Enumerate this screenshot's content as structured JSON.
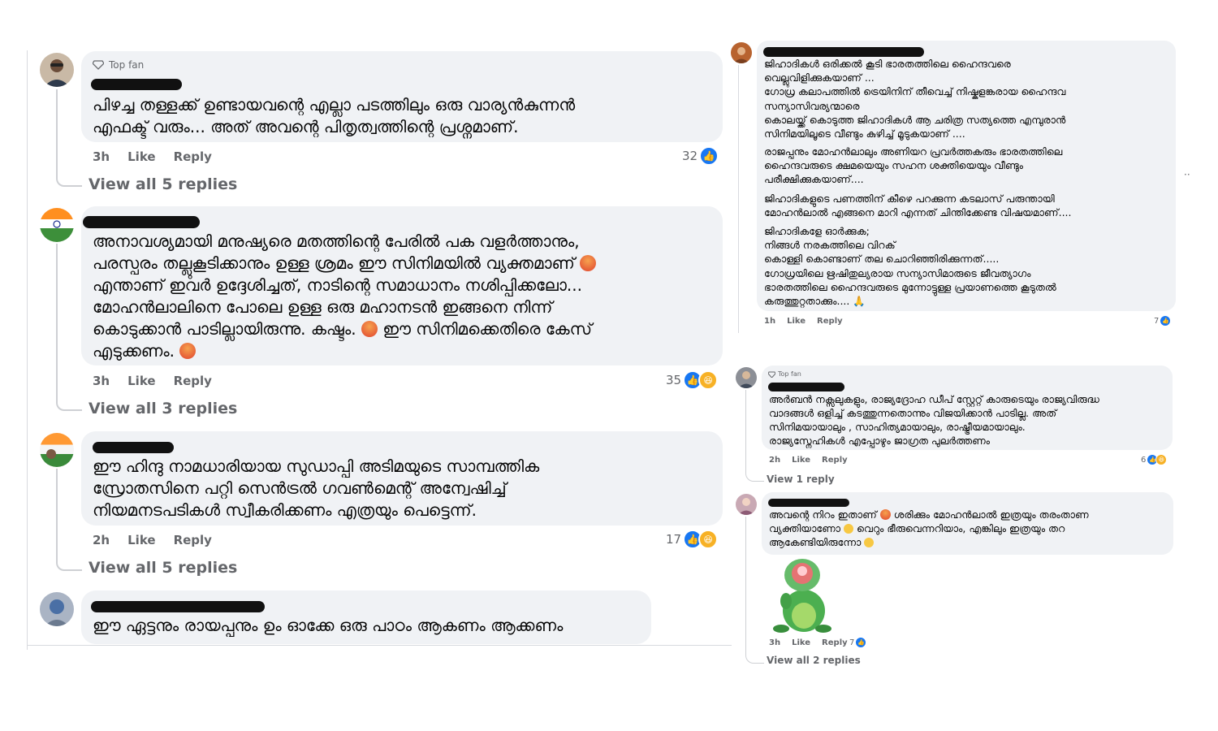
{
  "left": {
    "comments": [
      {
        "badge": "Top fan",
        "text": "പിഴച്ച തള്ളക്ക് ഉണ്ടായവന്റെ എല്ലാ പടത്തിലും ഒരു വാര്യൻകുന്നൻ\nഎഫക്ട് വരും... അത് അവന്റെ പിതൃത്വത്തിന്റെ പ്രശ്നമാണ്.",
        "time": "3h",
        "like": "Like",
        "reply": "Reply",
        "count": "32",
        "view_replies": "View all 5 replies"
      },
      {
        "text_lines": [
          "അനാവശ്യമായി മനുഷ്യരെ മതത്തിന്റെ പേരിൽ പക വളർത്താനും,",
          "പരസ്പരം തല്ലുകൂടിക്കാനും ഉള്ള ശ്രമം ഈ സിനിമയിൽ വ്യക്തമാണ്",
          "എന്താണ് ഇവർ ഉദ്ദേശിച്ചത്, നാടിന്റെ സമാധാനം നശിപ്പിക്കലോ...",
          "മോഹൻലാലിനെ പോലെ ഉള്ള ഒരു മഹാനടൻ ഇങ്ങനെ നിന്ന്",
          "കൊടുക്കാൻ പാടില്ലായിരുന്നു. കഷ്ടം.",
          " ഈ സിനിമക്കെതിരെ കേസ്",
          "എടുക്കണം."
        ],
        "time": "3h",
        "like": "Like",
        "reply": "Reply",
        "count": "35",
        "view_replies": "View all 3 replies"
      },
      {
        "text": "ഈ ഹിന്ദു നാമധാരിയായ സുഡാപ്പി അടിമയുടെ സാമ്പത്തിക\nസ്രോതസിനെ പറ്റി സെൻട്രൽ ഗവൺമെന്റ് അന്വേഷിച്ച്\nനിയമനടപടികൾ സ്വീകരിക്കണം എത്രയും പെട്ടെന്ന്.",
        "time": "2h",
        "like": "Like",
        "reply": "Reply",
        "count": "17",
        "view_replies": "View all 5 replies"
      },
      {
        "text": "ഈ ഏട്ടനും രായപ്പനും ഉം ഓക്കേ ഒരു പാഠം ആകണം ആക്കണം"
      }
    ]
  },
  "right": {
    "comments": [
      {
        "paragraphs": [
          "ജിഹാദികൾ ഒരിക്കൽ കൂടി ഭാരതത്തിലെ ഹൈന്ദവരെ\nവെല്ലുവിളിക്കുകയാണ് ...\nഗോധ്ര കലാപത്തിൽ ട്രെയിനിന് തീവെച്ച് നിഷ്കളങ്കരായ ഹൈന്ദവ\nസന്യാസിവര്യന്മാരെ\nകൊലയ്ക്ക് കൊടുത്ത ജിഹാദികൾ ആ ചരിത്ര സത്യത്തെ എമ്പുരാൻ\nസിനിമയിലൂടെ വീണ്ടും കുഴിച്ച് മൂടുകയാണ് ....",
          "രാജപ്പനും മോഹൻലാലും അണിയറ പ്രവർത്തകരും ഭാരതത്തിലെ\nഹൈന്ദവരുടെ ക്ഷമയെയും സഹന ശക്തിയെയും വീണ്ടും\nപരീക്ഷിക്കുകയാണ്....",
          "ജിഹാദികളുടെ പണത്തിന് കീഴെ പറക്കുന്ന കടലാസ് പരുന്തായി\nമോഹൻലാൽ എങ്ങനെ മാറി എന്നത് ചിന്തിക്കേണ്ട വിഷയമാണ്....",
          "ജിഹാദികളേ ഓർക്കുക;\nനിങ്ങൾ നരകത്തിലെ വിറക്\nകൊള്ളി കൊണ്ടാണ് തല ചൊറിഞ്ഞിരിക്കുന്നത്.....\nഗോധ്രയിലെ ഋഷിതുല്യരായ സന്യാസിമാരുടെ ജീവത്യാഗം\nഭാരതത്തിലെ ഹൈന്ദവരുടെ മുന്നോട്ടുള്ള പ്രയാണത്തെ കൂടുതൽ\nകരുത്തുറ്റതാക്കും.... 🙏"
        ],
        "time": "1h",
        "like": "Like",
        "reply": "Reply",
        "count": "7"
      },
      {
        "badge": "Top fan",
        "text": "അർബൻ നക്സലുകളും, രാജ്യദ്രോഹ ഡീപ് സ്റ്റേറ്റ് കാരുടെയും രാജ്യവിരുദ്ധ\nവാദങ്ങൾ ഒളിച്ച് കടത്തുന്നതൊന്നും വിജയിക്കാൻ പാടില്ല. അത്\nസിനിമയായാലും , സാഹിത്യമായാലും, രാഷ്ട്രീയമായാലും.\nരാജ്യസ്നേഹികൾ എപ്പോഴും ജാഗ്രത പുലർത്തണം",
        "time": "2h",
        "like": "Like",
        "reply": "Reply",
        "count": "6",
        "view_replies": "View 1 reply"
      },
      {
        "line1a": "അവന്റെ നിറം ഇതാണ് ",
        "line1b": " ശരിക്കും മോഹൻലാൽ ഇത്രയും തരംതാണ",
        "line2a": "വ്യക്തിയാണോ ",
        "line2b": " വെറും ഭീരുവെന്നറിയാം, എങ്കിലും ഇത്രയും തറ",
        "line3a": "ആകേണ്ടിയിരുന്നോ ",
        "time": "3h",
        "like": "Like",
        "reply": "Reply",
        "count": "7",
        "view_replies": "View all 2 replies"
      }
    ],
    "dots": "··"
  },
  "icons": {
    "like": "thumbs-up-icon",
    "haha": "haha-icon",
    "angry": "angry-face-icon",
    "badge": "diamond-badge-icon",
    "pray": "praying-hands-icon",
    "sleepy": "sleepy-face-icon"
  },
  "colors": {
    "like_blue": "#1877f2",
    "bubble": "#f0f2f5",
    "meta_gray": "#65676b"
  }
}
